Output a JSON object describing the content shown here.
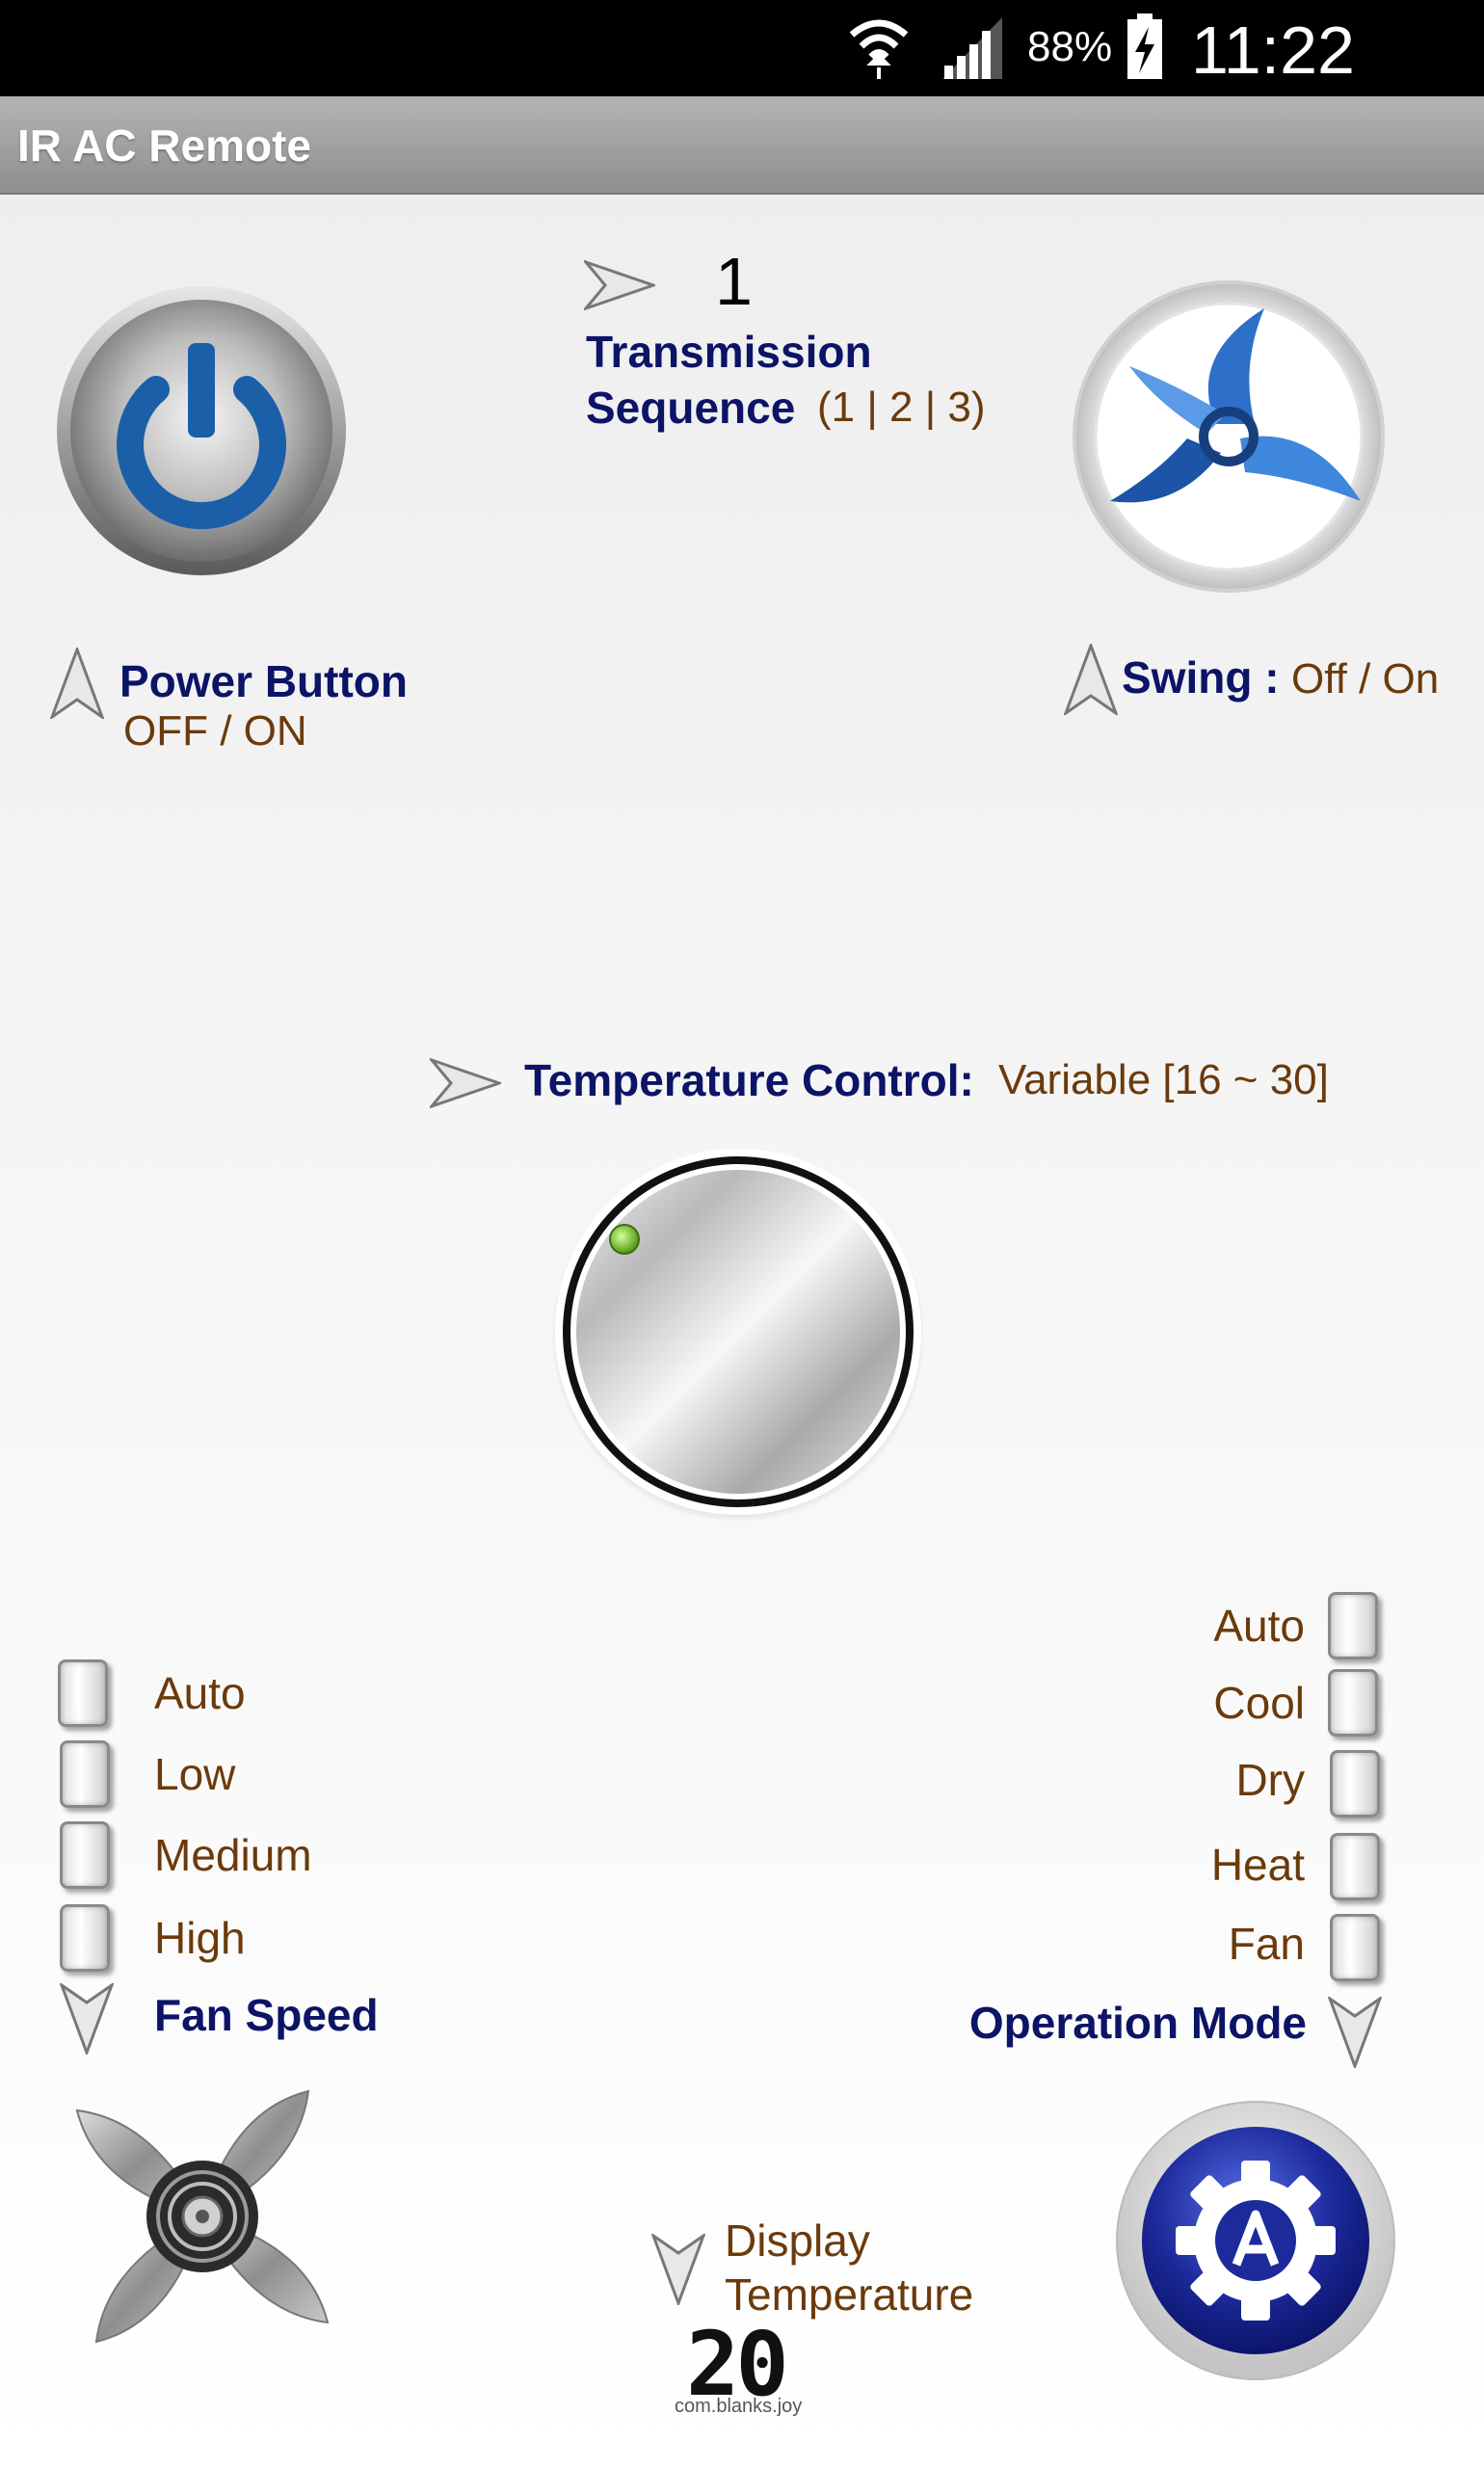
{
  "status_bar": {
    "battery": "88%",
    "time": "11:22"
  },
  "app": {
    "title": "IR AC Remote"
  },
  "transmission": {
    "value": "1",
    "label_line1": "Transmission",
    "label_line2": "Sequence",
    "options": "(1 | 2 | 3)"
  },
  "power": {
    "label": "Power Button",
    "states": "OFF / ON"
  },
  "swing": {
    "label": "Swing :",
    "states": "Off / On"
  },
  "temperature": {
    "label": "Temperature Control:",
    "range": "Variable [16 ~ 30]"
  },
  "fan_speed": {
    "title": "Fan Speed",
    "options": [
      "Auto",
      "Low",
      "Medium",
      "High"
    ]
  },
  "operation_mode": {
    "title": "Operation Mode",
    "options": [
      "Auto",
      "Cool",
      "Dry",
      "Heat",
      "Fan"
    ]
  },
  "display": {
    "label_line1": "Display",
    "label_line2": "Temperature",
    "value": "20",
    "package": "com.blanks.joy"
  },
  "icons": {
    "power": "power-icon",
    "swing": "swing-icon",
    "knob": "temperature-knob",
    "fan": "fan-icon",
    "mode": "mode-gear-icon",
    "arrow": "arrow-pointer-icon"
  },
  "colors": {
    "label_blue": "#0c1466",
    "label_brown": "#6b3a0b",
    "power_blue": "#1a5fa8",
    "mode_blue": "#1c2a9c"
  }
}
